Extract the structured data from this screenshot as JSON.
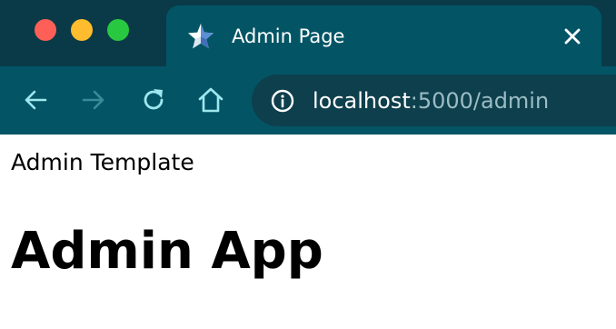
{
  "window": {
    "controls": [
      "close",
      "minimize",
      "zoom"
    ]
  },
  "tab": {
    "title": "Admin Page",
    "icon": "star-favicon-icon",
    "close_icon": "close-icon"
  },
  "toolbar": {
    "back_icon": "back-arrow-icon",
    "forward_icon": "forward-arrow-icon",
    "reload_icon": "reload-icon",
    "home_icon": "home-icon"
  },
  "address": {
    "info_icon": "info-icon",
    "host": "localhost",
    "rest": ":5000/admin"
  },
  "page": {
    "template_label": "Admin Template",
    "title": "Admin App"
  },
  "colors": {
    "tabstrip": "#0a3a47",
    "active_tab": "#035566",
    "urlbar": "#0e3f4c",
    "icon_active": "#9fe7ef",
    "icon_disabled": "#3a8a98"
  }
}
